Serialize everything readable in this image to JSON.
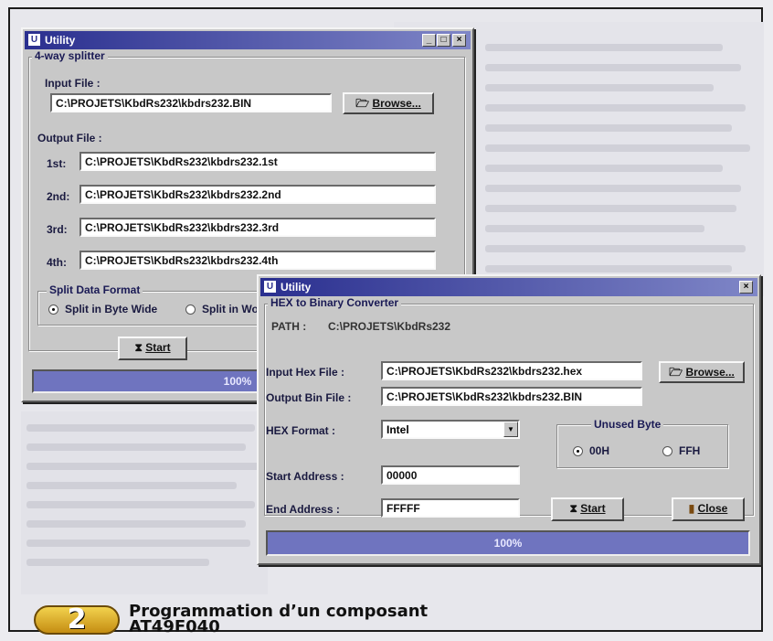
{
  "colors": {
    "title_bar": "#2a2f8f",
    "progress": "#6f74bf",
    "badge": "#e2b535"
  },
  "win1": {
    "title": "Utility",
    "group_label": "4-way splitter",
    "input_label": "Input File :",
    "input_value": "C:\\PROJETS\\KbdRs232\\kbdrs232.BIN",
    "browse_label": "Browse...",
    "output_label": "Output File :",
    "outputs": [
      {
        "label": "1st:",
        "value": "C:\\PROJETS\\KbdRs232\\kbdrs232.1st"
      },
      {
        "label": "2nd:",
        "value": "C:\\PROJETS\\KbdRs232\\kbdrs232.2nd"
      },
      {
        "label": "3rd:",
        "value": "C:\\PROJETS\\KbdRs232\\kbdrs232.3rd"
      },
      {
        "label": "4th:",
        "value": "C:\\PROJETS\\KbdRs232\\kbdrs232.4th"
      }
    ],
    "split_group": "Split Data Format",
    "radio1": "Split in Byte Wide",
    "radio2": "Split in Wo",
    "start_label": "Start",
    "progress_text": "100%",
    "progress_value": 100
  },
  "win2": {
    "title": "Utility",
    "group_label": "HEX  to Binary Converter",
    "path_label": "PATH :",
    "path_value": "C:\\PROJETS\\KbdRs232",
    "in_label": "Input Hex File :",
    "in_value": "C:\\PROJETS\\KbdRs232\\kbdrs232.hex",
    "browse_label": "Browse...",
    "out_label": "Output Bin File :",
    "out_value": "C:\\PROJETS\\KbdRs232\\kbdrs232.BIN",
    "format_label": "HEX Format :",
    "format_value": "Intel",
    "unused_label": "Unused Byte",
    "unused_opt1": "00H",
    "unused_opt2": "FFH",
    "start_addr_label": "Start Address :",
    "start_addr_value": "00000",
    "end_addr_label": "End Address :",
    "end_addr_value": "FFFFF",
    "start_label": "Start",
    "close_label": "Close",
    "progress_text": "100%",
    "progress_value": 100
  },
  "caption": {
    "number": "2",
    "line1": "Programmation d’un composant",
    "line2": "AT49F040"
  }
}
